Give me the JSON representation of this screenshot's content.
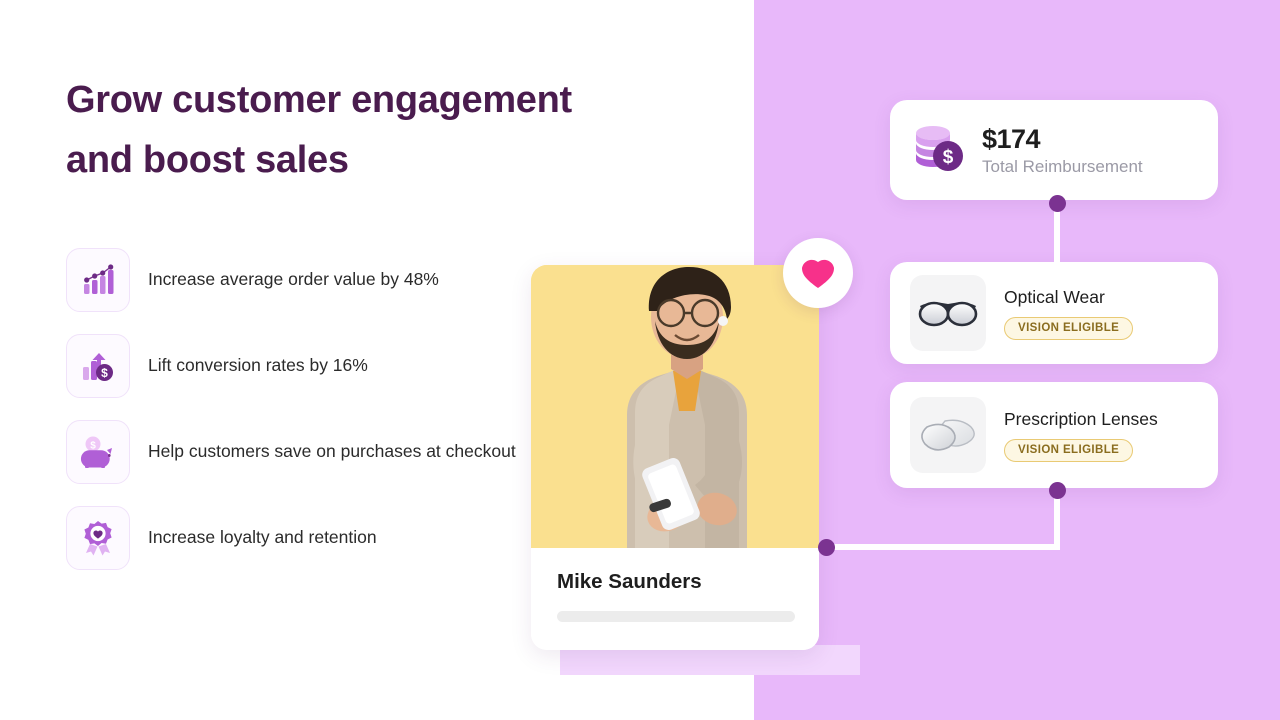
{
  "headline": {
    "line1": "Grow customer engagement",
    "line2": "and boost sales"
  },
  "features": [
    {
      "icon": "bar-chart-growth-icon",
      "text": "Increase average order value by 48%"
    },
    {
      "icon": "arrow-up-dollar-coin-icon",
      "text": "Lift conversion rates by 16%"
    },
    {
      "icon": "piggy-bank-icon",
      "text": "Help customers save on purchases at checkout"
    },
    {
      "icon": "award-ribbon-heart-icon",
      "text": "Increase loyalty and retention"
    }
  ],
  "profile_card": {
    "name": "Mike Saunders",
    "favorite_icon": "heart-icon"
  },
  "reimbursement": {
    "icon": "coin-stack-dollar-icon",
    "amount": "$174",
    "label": "Total Reimbursement"
  },
  "products": [
    {
      "icon": "eyeglasses-icon",
      "title": "Optical Wear",
      "badge": "VISION ELIGIBLE"
    },
    {
      "icon": "lenses-icon",
      "title": "Prescription Lenses",
      "badge": "VISION ELIGIBLE"
    }
  ],
  "colors": {
    "panel_purple": "#e8b8fa",
    "headline_purple": "#4a1c4e",
    "accent_purple": "#7b3391",
    "icon_purple": "#b05fd6",
    "heart_pink": "#f7318a",
    "photo_yellow": "#fae08f",
    "badge_gold": "#8a6d1f"
  }
}
